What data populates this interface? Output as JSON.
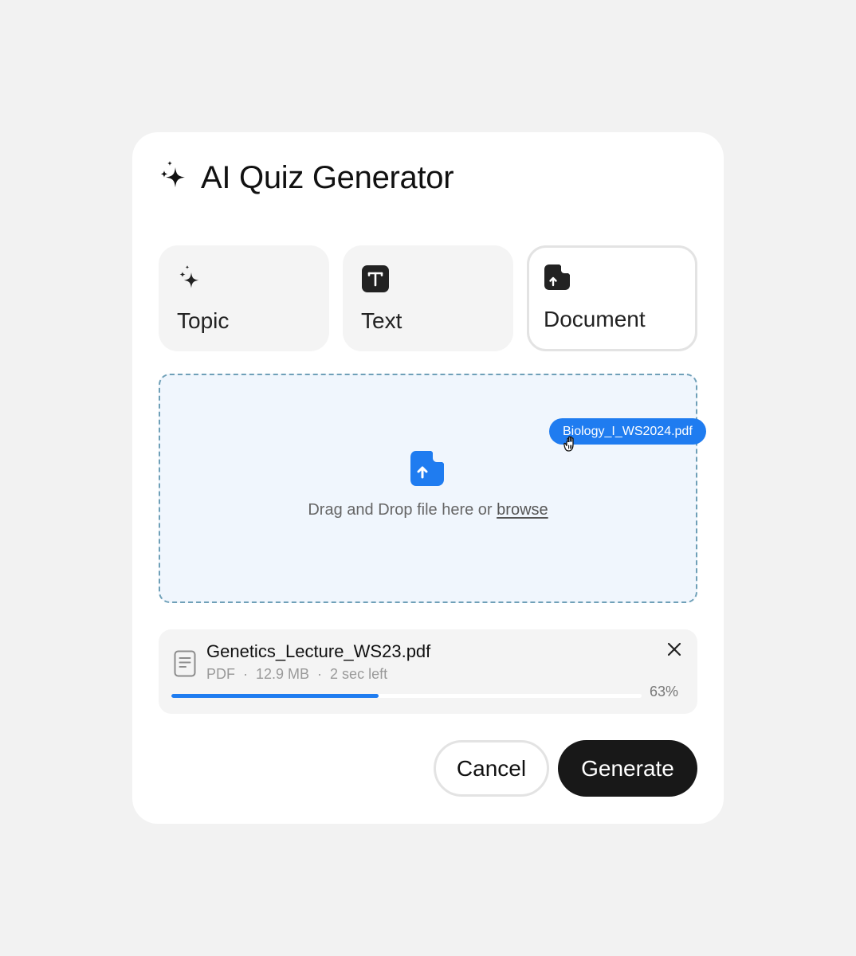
{
  "dialog": {
    "title": "AI Quiz Generator",
    "title_icon": "sparkles-icon"
  },
  "tabs": [
    {
      "label": "Topic",
      "icon": "sparkles-icon",
      "active": false
    },
    {
      "label": "Text",
      "icon": "text-icon",
      "active": false
    },
    {
      "label": "Document",
      "icon": "document-upload-icon",
      "active": true
    }
  ],
  "dropzone": {
    "prompt": "Drag and Drop file here or ",
    "browse_label": "browse",
    "icon": "file-upload-icon",
    "accent_color": "#1f7cf0"
  },
  "dragging_file": {
    "name": "Biology_I_WS2024.pdf"
  },
  "upload": {
    "file_name": "Genetics_Lecture_WS23.pdf",
    "type": "PDF",
    "size": "12.9 MB",
    "time_left": "2 sec left",
    "separator": "·",
    "progress_label": "63%",
    "progress_fraction": 0.44
  },
  "actions": {
    "cancel_label": "Cancel",
    "generate_label": "Generate"
  }
}
